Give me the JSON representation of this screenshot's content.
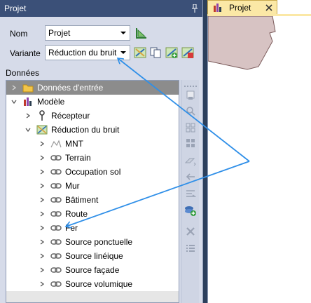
{
  "panel": {
    "title": "Projet",
    "pin_icon": "pin-icon"
  },
  "form": {
    "nom_label": "Nom",
    "nom_value": "Projet",
    "variante_label": "Variante",
    "variante_value": "Réduction du bruit"
  },
  "donnees_label": "Données",
  "tree": {
    "items": [
      {
        "label": "Données d'entrée",
        "icon": "folder-icon"
      },
      {
        "label": "Modèle",
        "icon": "model-icon"
      },
      {
        "label": "Récepteur",
        "icon": "receiver-pin-icon"
      },
      {
        "label": "Réduction du bruit",
        "icon": "map-variant-icon"
      },
      {
        "label": "MNT",
        "icon": "terrain-model-icon"
      },
      {
        "label": "Terrain",
        "icon": "link-icon"
      },
      {
        "label": "Occupation sol",
        "icon": "link-icon"
      },
      {
        "label": "Mur",
        "icon": "link-icon"
      },
      {
        "label": "Bâtiment",
        "icon": "link-icon"
      },
      {
        "label": "Route",
        "icon": "link-icon"
      },
      {
        "label": "Fer",
        "icon": "link-icon"
      },
      {
        "label": "Source ponctuelle",
        "icon": "link-icon"
      },
      {
        "label": "Source linéique",
        "icon": "link-icon"
      },
      {
        "label": "Source façade",
        "icon": "link-icon"
      },
      {
        "label": "Source volumique",
        "icon": "link-icon"
      }
    ]
  },
  "doc_tab": {
    "title": "Projet"
  },
  "colors": {
    "title_bar": "#3b5078",
    "panel_bg": "#d6dbe9",
    "tab_bg": "#fbe8a6",
    "arrow": "#2f8fe8",
    "map_shape": "#d7c3c3"
  }
}
